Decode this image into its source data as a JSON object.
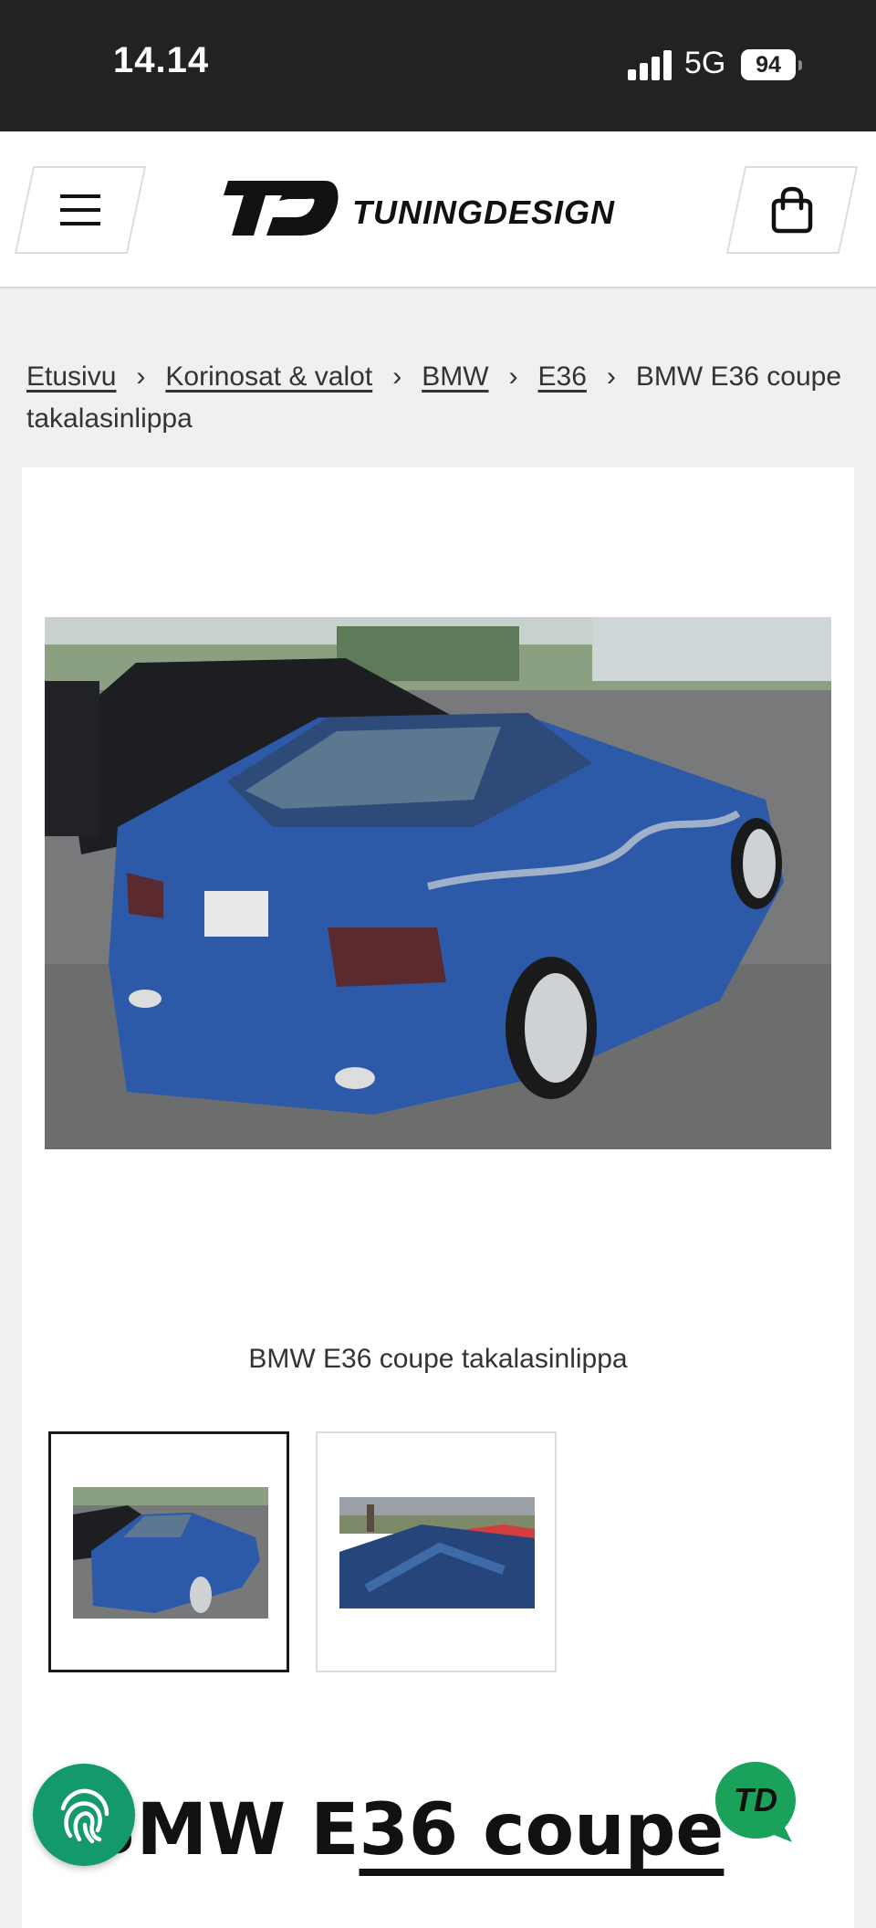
{
  "status_bar": {
    "time": "14.14",
    "network": "5G",
    "battery": "94"
  },
  "header": {
    "brand_name": "TUNINGDESIGN",
    "brand_mark": "TD",
    "menu_icon": "hamburger-menu-icon",
    "cart_icon": "shopping-bag-icon"
  },
  "breadcrumb": {
    "items": [
      "Etusivu",
      "Korinosat & valot",
      "BMW",
      "E36"
    ],
    "current": "BMW E36 coupe takalasinlippa"
  },
  "product": {
    "image_caption": "BMW E36 coupe takalasinlippa",
    "title_part1": "BMW E",
    "title_part2": "36 coupe",
    "thumbnails": [
      {
        "label": "thumbnail-1",
        "selected": true
      },
      {
        "label": "thumbnail-2",
        "selected": false
      }
    ]
  },
  "colors": {
    "status_bar": "#222222",
    "page_bg": "#eff0ef",
    "accent_green": "#13996b",
    "chat_green": "#1aa15a"
  }
}
